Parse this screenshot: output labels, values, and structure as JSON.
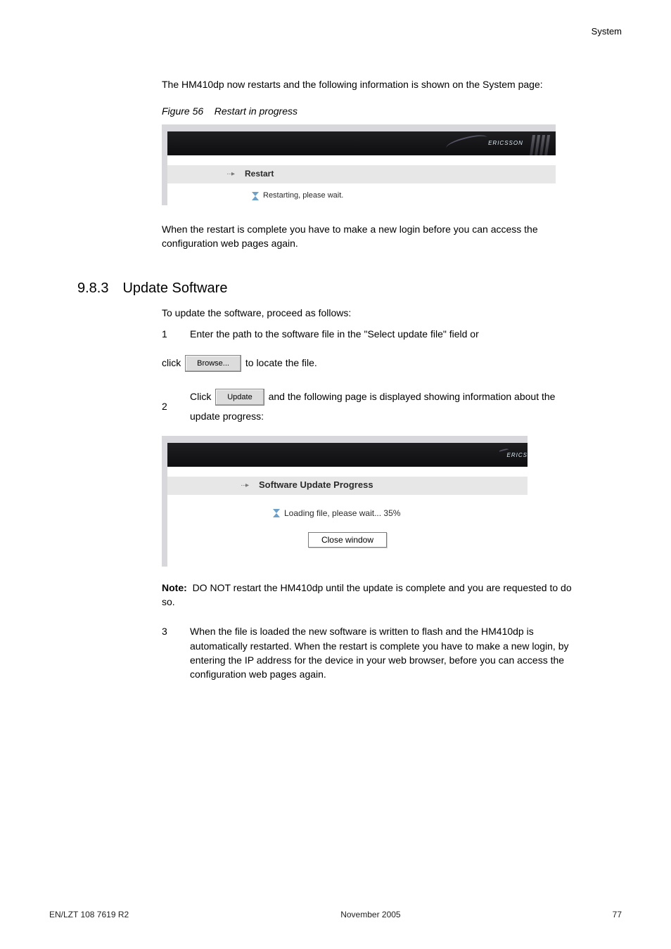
{
  "header": {
    "right": "System"
  },
  "intro": "The HM410dp now restarts and the following information is shown on the System page:",
  "fig1": {
    "caption_prefix": "Figure 56",
    "caption_text": "Restart in progress",
    "banner_logo": "ERICSSON",
    "title": "Restart",
    "status": "Restarting, please wait."
  },
  "after_restart": "When the restart is complete you have to make a new login before you can access the configuration web pages again.",
  "section": {
    "number": "9.8.3",
    "title": "Update Software"
  },
  "update_intro": "To update the software, proceed as follows:",
  "steps": {
    "s1": {
      "n": "1",
      "text": "Enter the path to the software file in the \"Select update file\" field or"
    },
    "s1b": {
      "pre": "click ",
      "btn": "Browse...",
      "post": " to locate the file."
    },
    "s2": {
      "n": "2",
      "pre": "Click ",
      "btn": "Update",
      "post": " and the following page is displayed showing information about the update progress:"
    }
  },
  "fig2": {
    "banner_logo": "ERICS",
    "title": "Software Update Progress",
    "status": "Loading file, please wait... 35%",
    "close_btn": "Close window"
  },
  "note": {
    "label": "Note:",
    "text": "DO NOT restart the HM410dp until the update is complete and you are requested to do so."
  },
  "step3": {
    "n": "3",
    "text": "When the file is loaded the new software is written to flash and the HM410dp is automatically restarted. When the restart is complete you have to make a new login, by entering the IP address for the device in your web browser, before you can access the configuration web pages again."
  },
  "footer": {
    "left": "EN/LZT 108 7619 R2",
    "center": "November 2005",
    "right": "77"
  }
}
